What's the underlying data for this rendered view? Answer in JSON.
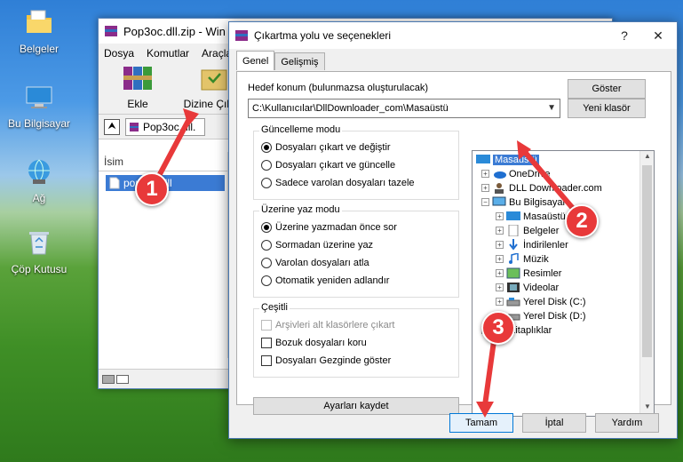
{
  "desktop": {
    "icons": [
      {
        "label": "Belgeler"
      },
      {
        "label": "Bu Bilgisayar"
      },
      {
        "label": "Ağ"
      },
      {
        "label": "Çöp Kutusu"
      }
    ]
  },
  "rar_window": {
    "title": "Pop3oc.dll.zip - Win",
    "menu": [
      "Dosya",
      "Komutlar",
      "Araçla"
    ],
    "toolbar": {
      "add_label": "Ekle",
      "extract_label": "Dizine Çıkart"
    },
    "address": "Pop3oc.dll.",
    "column_name": "İsim",
    "file_name": "pop3oc.dll"
  },
  "dialog": {
    "title": "Çıkartma yolu ve seçenekleri",
    "tabs": [
      "Genel",
      "Gelişmiş"
    ],
    "target_label": "Hedef konum (bulunmazsa oluşturulacak)",
    "target_value": "C:\\Kullanıcılar\\DllDownloader_com\\Masaüstü",
    "show_button": "Göster",
    "new_folder_button": "Yeni klasör",
    "update_mode": {
      "title": "Güncelleme modu",
      "options": [
        "Dosyaları çıkart ve değiştir",
        "Dosyaları çıkart ve güncelle",
        "Sadece varolan dosyaları tazele"
      ],
      "selected": 0
    },
    "overwrite_mode": {
      "title": "Üzerine yaz modu",
      "options": [
        "Üzerine yazmadan önce sor",
        "Sormadan üzerine yaz",
        "Varolan dosyaları atla",
        "Otomatik yeniden adlandır"
      ],
      "selected": 0
    },
    "misc": {
      "title": "Çeşitli",
      "options": [
        "Arşivleri alt klasörlere çıkart",
        "Bozuk dosyaları koru",
        "Dosyaları Gezginde göster"
      ]
    },
    "save_settings_button": "Ayarları kaydet",
    "tree": [
      {
        "label": "Masaüstü",
        "level": 0,
        "selected": true
      },
      {
        "label": "OneDrive",
        "level": 1
      },
      {
        "label": "DLL Downloader.com",
        "level": 1
      },
      {
        "label": "Bu Bilgisayar",
        "level": 1
      },
      {
        "label": "Masaüstü",
        "level": 2
      },
      {
        "label": "Belgeler",
        "level": 2
      },
      {
        "label": "İndirilenler",
        "level": 2
      },
      {
        "label": "Müzik",
        "level": 2
      },
      {
        "label": "Resimler",
        "level": 2
      },
      {
        "label": "Videolar",
        "level": 2
      },
      {
        "label": "Yerel Disk (C:)",
        "level": 2
      },
      {
        "label": "Yerel Disk (D:)",
        "level": 2
      },
      {
        "label": "Kitaplıklar",
        "level": 1
      }
    ],
    "ok_button": "Tamam",
    "cancel_button": "İptal",
    "help_button": "Yardım"
  },
  "callouts": [
    "1",
    "2",
    "3"
  ],
  "colors": {
    "callout": "#e8393a",
    "selection": "#3b7bd4"
  }
}
